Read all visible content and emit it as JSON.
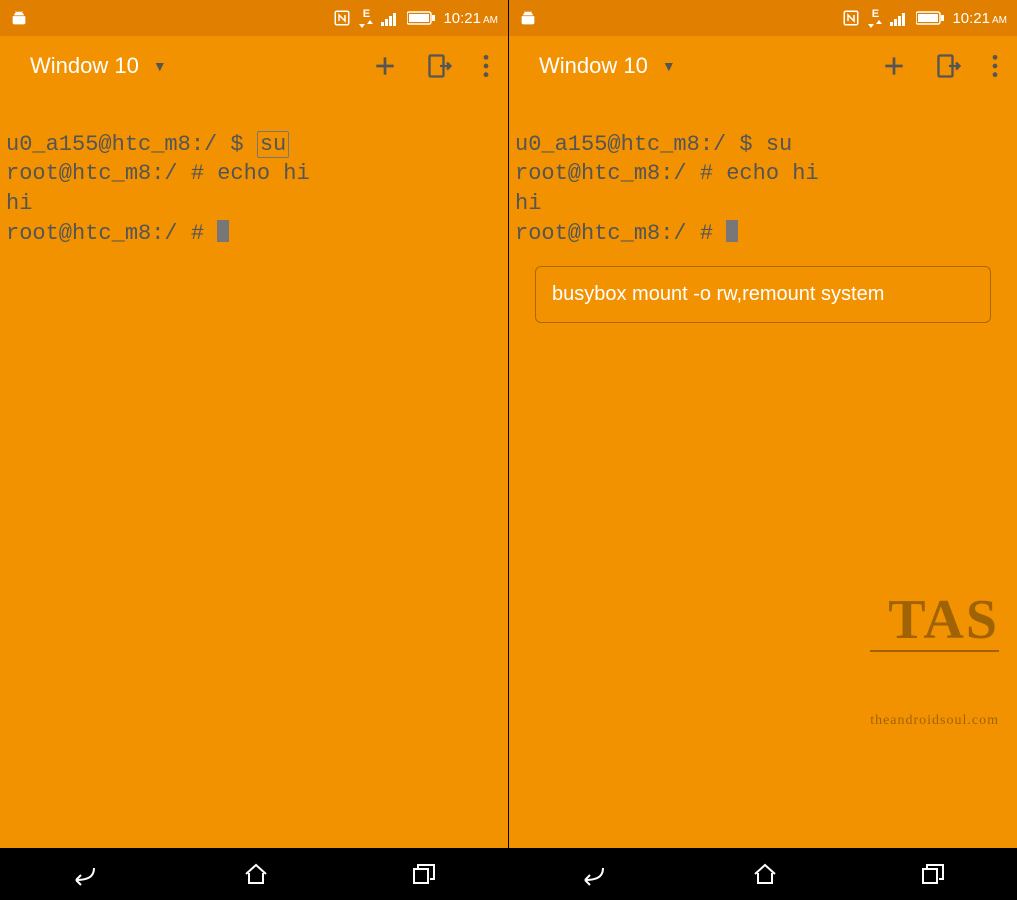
{
  "status": {
    "time": "10:21",
    "ampm": "AM",
    "network_label": "E"
  },
  "toolbar": {
    "window_label": "Window 10"
  },
  "left_term": {
    "line1_prefix": "u0_a155@htc_m8:/ $ ",
    "line1_cmd": "su",
    "line2": "root@htc_m8:/ # echo hi",
    "line3": "hi",
    "line4_prompt": "root@htc_m8:/ # "
  },
  "right_term": {
    "line1": "u0_a155@htc_m8:/ $ su",
    "line2": "root@htc_m8:/ # echo hi",
    "line3": "hi",
    "line4_prompt": "root@htc_m8:/ # ",
    "suggestion": "busybox mount -o rw,remount system"
  },
  "watermark": {
    "big": "TAS",
    "small": "theandroidsoul.com"
  }
}
